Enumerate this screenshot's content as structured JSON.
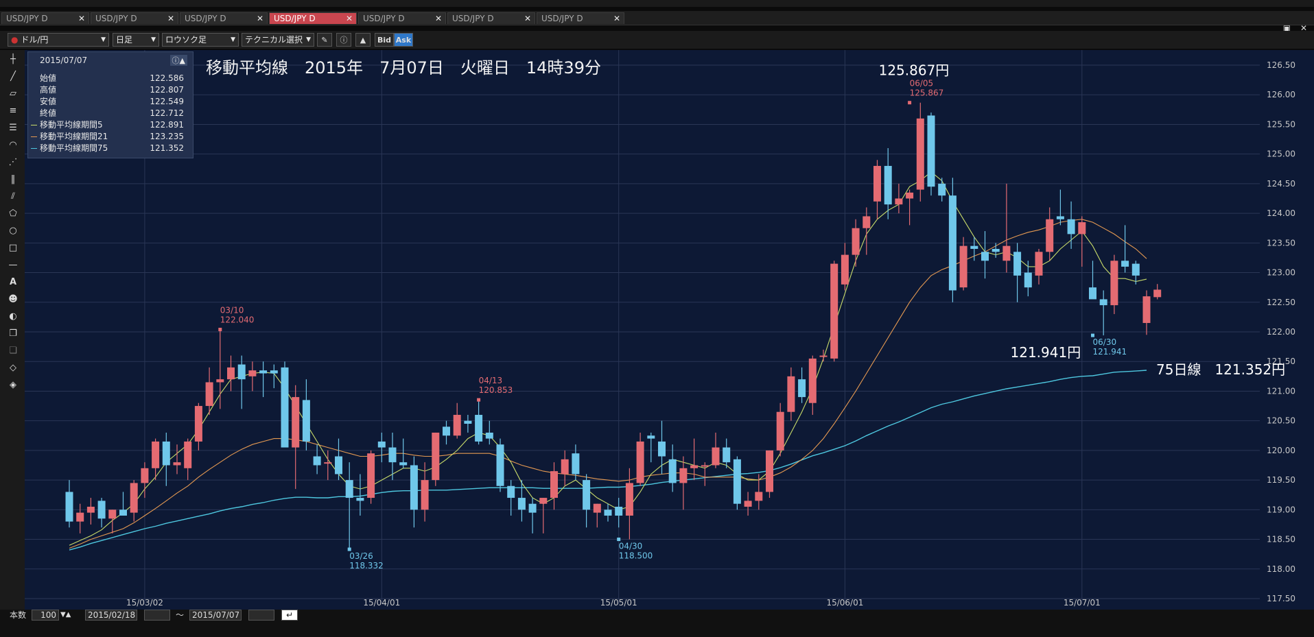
{
  "tabs": [
    {
      "label": "USD/JPY D",
      "active": false
    },
    {
      "label": "USD/JPY D",
      "active": false
    },
    {
      "label": "USD/JPY D",
      "active": false
    },
    {
      "label": "USD/JPY D",
      "active": true
    },
    {
      "label": "USD/JPY D",
      "active": false
    },
    {
      "label": "USD/JPY D",
      "active": false
    },
    {
      "label": "USD/JPY D",
      "active": false
    }
  ],
  "toolbar": {
    "currency": "ドル/円",
    "period": "日足",
    "chart_type": "ロウソク足",
    "technical": "テクニカル選択",
    "bid": "Bid",
    "ask": "Ask"
  },
  "info": {
    "date": "2015/07/07",
    "rows": [
      {
        "label": "始値",
        "value": "122.586"
      },
      {
        "label": "高値",
        "value": "122.807"
      },
      {
        "label": "安値",
        "value": "122.549"
      },
      {
        "label": "終値",
        "value": "122.712"
      },
      {
        "label": "移動平均線期間5",
        "value": "122.891"
      },
      {
        "label": "移動平均線期間21",
        "value": "123.235"
      },
      {
        "label": "移動平均線期間75",
        "value": "121.352"
      }
    ]
  },
  "bottom": {
    "count_label": "本数",
    "count": "100",
    "from": "2015/02/18",
    "tilde": "～",
    "to": "2015/07/07"
  },
  "colors": {
    "up": "#e46b72",
    "down": "#6fc7ea",
    "ma5": "#c9dc6a",
    "ma21": "#e69a52",
    "ma75": "#4ec8e0",
    "background": "#0d1935",
    "grid": "#2a3656"
  },
  "chart_data": {
    "type": "candlestick",
    "title": "移動平均線　2015年　7月07日　火曜日　14時39分",
    "ylim": [
      117.5,
      126.5
    ],
    "yticks": [
      "117.50",
      "118.00",
      "118.50",
      "119.00",
      "119.50",
      "120.00",
      "120.50",
      "121.00",
      "121.50",
      "122.00",
      "122.50",
      "123.00",
      "123.50",
      "124.00",
      "124.50",
      "125.00",
      "125.50",
      "126.00",
      "126.50"
    ],
    "xticks": [
      {
        "label": "15/03/02",
        "index": 7
      },
      {
        "label": "15/04/01",
        "index": 29
      },
      {
        "label": "15/05/01",
        "index": 51
      },
      {
        "label": "15/06/01",
        "index": 72
      },
      {
        "label": "15/07/01",
        "index": 94
      }
    ],
    "candles": [
      {
        "o": 119.3,
        "h": 119.5,
        "l": 118.7,
        "c": 118.8
      },
      {
        "o": 118.8,
        "h": 119.1,
        "l": 118.6,
        "c": 118.95
      },
      {
        "o": 118.95,
        "h": 119.2,
        "l": 118.75,
        "c": 119.05
      },
      {
        "o": 119.15,
        "h": 119.2,
        "l": 118.7,
        "c": 118.85
      },
      {
        "o": 118.85,
        "h": 119.0,
        "l": 118.6,
        "c": 119.0
      },
      {
        "o": 119.0,
        "h": 119.3,
        "l": 118.9,
        "c": 118.9
      },
      {
        "o": 118.95,
        "h": 119.5,
        "l": 118.8,
        "c": 119.45
      },
      {
        "o": 119.45,
        "h": 119.8,
        "l": 119.2,
        "c": 119.7
      },
      {
        "o": 119.7,
        "h": 120.2,
        "l": 119.5,
        "c": 120.15
      },
      {
        "o": 120.15,
        "h": 120.3,
        "l": 119.4,
        "c": 119.75
      },
      {
        "o": 119.75,
        "h": 120.1,
        "l": 119.6,
        "c": 119.8
      },
      {
        "o": 119.7,
        "h": 120.2,
        "l": 119.5,
        "c": 120.15
      },
      {
        "o": 120.15,
        "h": 120.8,
        "l": 120.0,
        "c": 120.75
      },
      {
        "o": 120.75,
        "h": 121.4,
        "l": 120.6,
        "c": 121.15
      },
      {
        "o": 121.15,
        "h": 122.04,
        "l": 120.7,
        "c": 121.2
      },
      {
        "o": 121.2,
        "h": 121.6,
        "l": 121.0,
        "c": 121.4
      },
      {
        "o": 121.45,
        "h": 121.6,
        "l": 120.7,
        "c": 121.2
      },
      {
        "o": 121.25,
        "h": 121.5,
        "l": 121.0,
        "c": 121.35
      },
      {
        "o": 121.35,
        "h": 121.5,
        "l": 120.9,
        "c": 121.3
      },
      {
        "o": 121.35,
        "h": 121.45,
        "l": 121.05,
        "c": 121.3
      },
      {
        "o": 121.4,
        "h": 121.5,
        "l": 121.0,
        "c": 120.05
      },
      {
        "o": 120.05,
        "h": 121.1,
        "l": 119.35,
        "c": 120.9
      },
      {
        "o": 120.85,
        "h": 121.2,
        "l": 120.0,
        "c": 120.15
      },
      {
        "o": 119.9,
        "h": 120.1,
        "l": 119.6,
        "c": 119.75
      },
      {
        "o": 119.8,
        "h": 120.0,
        "l": 119.5,
        "c": 119.8
      },
      {
        "o": 119.9,
        "h": 120.2,
        "l": 119.5,
        "c": 119.6
      },
      {
        "o": 119.5,
        "h": 119.8,
        "l": 118.332,
        "c": 119.2
      },
      {
        "o": 119.2,
        "h": 119.6,
        "l": 118.9,
        "c": 119.15
      },
      {
        "o": 119.2,
        "h": 120.0,
        "l": 119.1,
        "c": 119.95
      },
      {
        "o": 120.15,
        "h": 120.3,
        "l": 119.8,
        "c": 120.05
      },
      {
        "o": 120.05,
        "h": 120.3,
        "l": 119.5,
        "c": 119.8
      },
      {
        "o": 119.8,
        "h": 120.2,
        "l": 119.7,
        "c": 119.75
      },
      {
        "o": 119.75,
        "h": 119.9,
        "l": 118.7,
        "c": 119.0
      },
      {
        "o": 119.0,
        "h": 119.8,
        "l": 118.8,
        "c": 119.5
      },
      {
        "o": 119.5,
        "h": 120.3,
        "l": 119.4,
        "c": 120.3
      },
      {
        "o": 120.4,
        "h": 120.5,
        "l": 120.1,
        "c": 120.25
      },
      {
        "o": 120.25,
        "h": 120.8,
        "l": 120.2,
        "c": 120.6
      },
      {
        "o": 120.5,
        "h": 120.6,
        "l": 120.3,
        "c": 120.45
      },
      {
        "o": 120.6,
        "h": 120.853,
        "l": 120.1,
        "c": 120.15
      },
      {
        "o": 120.3,
        "h": 120.5,
        "l": 120.1,
        "c": 120.2
      },
      {
        "o": 120.1,
        "h": 120.2,
        "l": 119.3,
        "c": 119.4
      },
      {
        "o": 119.4,
        "h": 119.5,
        "l": 118.9,
        "c": 119.2
      },
      {
        "o": 119.2,
        "h": 119.5,
        "l": 118.8,
        "c": 119.0
      },
      {
        "o": 119.1,
        "h": 119.2,
        "l": 118.6,
        "c": 118.95
      },
      {
        "o": 119.1,
        "h": 119.2,
        "l": 118.6,
        "c": 119.2
      },
      {
        "o": 119.2,
        "h": 119.8,
        "l": 119.0,
        "c": 119.65
      },
      {
        "o": 119.6,
        "h": 120.0,
        "l": 119.4,
        "c": 119.85
      },
      {
        "o": 119.95,
        "h": 120.1,
        "l": 119.5,
        "c": 119.6
      },
      {
        "o": 119.5,
        "h": 119.6,
        "l": 118.7,
        "c": 119.0
      },
      {
        "o": 118.95,
        "h": 119.1,
        "l": 118.7,
        "c": 119.1
      },
      {
        "o": 119.0,
        "h": 119.1,
        "l": 118.8,
        "c": 118.9
      },
      {
        "o": 119.05,
        "h": 119.2,
        "l": 118.7,
        "c": 118.9
      },
      {
        "o": 118.9,
        "h": 119.7,
        "l": 118.5,
        "c": 119.45
      },
      {
        "o": 119.45,
        "h": 120.3,
        "l": 119.4,
        "c": 120.15
      },
      {
        "o": 120.25,
        "h": 120.3,
        "l": 119.8,
        "c": 120.2
      },
      {
        "o": 120.15,
        "h": 120.5,
        "l": 119.6,
        "c": 119.9
      },
      {
        "o": 119.85,
        "h": 120.1,
        "l": 119.3,
        "c": 119.45
      },
      {
        "o": 119.45,
        "h": 119.9,
        "l": 119.0,
        "c": 119.7
      },
      {
        "o": 119.7,
        "h": 120.2,
        "l": 119.5,
        "c": 119.75
      },
      {
        "o": 119.75,
        "h": 119.8,
        "l": 119.4,
        "c": 119.75
      },
      {
        "o": 119.75,
        "h": 120.3,
        "l": 119.7,
        "c": 120.05
      },
      {
        "o": 120.05,
        "h": 120.2,
        "l": 119.7,
        "c": 119.8
      },
      {
        "o": 119.85,
        "h": 119.9,
        "l": 119.0,
        "c": 119.1
      },
      {
        "o": 119.05,
        "h": 119.3,
        "l": 118.9,
        "c": 119.15
      },
      {
        "o": 119.15,
        "h": 119.6,
        "l": 119.0,
        "c": 119.3
      },
      {
        "o": 119.3,
        "h": 120.0,
        "l": 119.2,
        "c": 120.0
      },
      {
        "o": 120.0,
        "h": 120.8,
        "l": 119.9,
        "c": 120.65
      },
      {
        "o": 120.65,
        "h": 121.4,
        "l": 120.5,
        "c": 121.25
      },
      {
        "o": 121.2,
        "h": 121.4,
        "l": 120.8,
        "c": 120.9
      },
      {
        "o": 120.8,
        "h": 121.6,
        "l": 120.6,
        "c": 121.55
      },
      {
        "o": 121.6,
        "h": 121.7,
        "l": 121.5,
        "c": 121.6
      },
      {
        "o": 121.55,
        "h": 123.2,
        "l": 121.5,
        "c": 123.15
      },
      {
        "o": 122.8,
        "h": 123.5,
        "l": 122.7,
        "c": 123.3
      },
      {
        "o": 123.3,
        "h": 123.9,
        "l": 123.1,
        "c": 123.75
      },
      {
        "o": 123.75,
        "h": 124.1,
        "l": 123.3,
        "c": 123.95
      },
      {
        "o": 124.2,
        "h": 124.9,
        "l": 123.9,
        "c": 124.8
      },
      {
        "o": 124.8,
        "h": 125.1,
        "l": 123.9,
        "c": 124.15
      },
      {
        "o": 124.15,
        "h": 124.5,
        "l": 124.0,
        "c": 124.25
      },
      {
        "o": 124.25,
        "h": 124.4,
        "l": 123.8,
        "c": 124.35
      },
      {
        "o": 124.4,
        "h": 125.867,
        "l": 124.2,
        "c": 125.6
      },
      {
        "o": 125.65,
        "h": 125.7,
        "l": 124.3,
        "c": 124.45
      },
      {
        "o": 124.5,
        "h": 124.6,
        "l": 124.2,
        "c": 124.3
      },
      {
        "o": 124.3,
        "h": 124.6,
        "l": 122.5,
        "c": 122.7
      },
      {
        "o": 122.75,
        "h": 123.6,
        "l": 122.7,
        "c": 123.45
      },
      {
        "o": 123.45,
        "h": 123.6,
        "l": 123.2,
        "c": 123.4
      },
      {
        "o": 123.35,
        "h": 123.7,
        "l": 122.9,
        "c": 123.2
      },
      {
        "o": 123.4,
        "h": 123.5,
        "l": 123.25,
        "c": 123.35
      },
      {
        "o": 123.2,
        "h": 124.5,
        "l": 123.0,
        "c": 123.45
      },
      {
        "o": 123.35,
        "h": 123.5,
        "l": 122.5,
        "c": 122.95
      },
      {
        "o": 123.0,
        "h": 123.2,
        "l": 122.6,
        "c": 122.75
      },
      {
        "o": 122.95,
        "h": 123.4,
        "l": 122.8,
        "c": 123.35
      },
      {
        "o": 123.35,
        "h": 124.1,
        "l": 123.2,
        "c": 123.9
      },
      {
        "o": 123.95,
        "h": 124.4,
        "l": 123.8,
        "c": 123.9
      },
      {
        "o": 123.9,
        "h": 124.2,
        "l": 123.4,
        "c": 123.65
      },
      {
        "o": 123.65,
        "h": 123.95,
        "l": 123.1,
        "c": 123.85
      },
      {
        "o": 122.75,
        "h": 123.2,
        "l": 122.6,
        "c": 122.55
      },
      {
        "o": 122.55,
        "h": 122.7,
        "l": 121.941,
        "c": 122.45
      },
      {
        "o": 122.45,
        "h": 123.3,
        "l": 122.3,
        "c": 123.2
      },
      {
        "o": 123.2,
        "h": 123.8,
        "l": 123.0,
        "c": 123.1
      },
      {
        "o": 123.15,
        "h": 123.2,
        "l": 122.8,
        "c": 122.95
      },
      {
        "o": 122.15,
        "h": 122.7,
        "l": 121.95,
        "c": 122.6
      },
      {
        "o": 122.586,
        "h": 122.807,
        "l": 122.549,
        "c": 122.712
      }
    ],
    "series": [
      {
        "name": "移動平均線期間5",
        "values": [
          118.4,
          118.48,
          118.56,
          118.66,
          118.82,
          118.95,
          119.1,
          119.35,
          119.55,
          119.8,
          119.95,
          120.1,
          120.35,
          120.65,
          120.95,
          121.2,
          121.25,
          121.3,
          121.32,
          121.3,
          121.05,
          120.75,
          120.45,
          120.15,
          119.85,
          119.6,
          119.4,
          119.35,
          119.4,
          119.5,
          119.6,
          119.7,
          119.7,
          119.65,
          119.72,
          119.85,
          120.0,
          120.2,
          120.3,
          120.25,
          120.05,
          119.8,
          119.45,
          119.2,
          119.1,
          119.2,
          119.4,
          119.5,
          119.35,
          119.2,
          119.1,
          119.0,
          119.05,
          119.3,
          119.6,
          119.75,
          119.85,
          119.8,
          119.75,
          119.7,
          119.8,
          119.75,
          119.6,
          119.5,
          119.5,
          119.65,
          119.95,
          120.3,
          120.65,
          121.05,
          121.55,
          122.1,
          122.65,
          123.2,
          123.65,
          123.9,
          124.05,
          124.15,
          124.45,
          124.55,
          124.7,
          124.55,
          124.2,
          123.9,
          123.6,
          123.35,
          123.3,
          123.35,
          123.25,
          123.1,
          123.1,
          123.2,
          123.4,
          123.55,
          123.7,
          123.45,
          123.1,
          122.9,
          122.9,
          122.85,
          122.89
        ]
      },
      {
        "name": "移動平均線期間21",
        "values": [
          118.35,
          118.42,
          118.5,
          118.56,
          118.62,
          118.68,
          118.78,
          118.9,
          119.02,
          119.15,
          119.28,
          119.4,
          119.55,
          119.68,
          119.8,
          119.92,
          120.02,
          120.1,
          120.15,
          120.2,
          120.2,
          120.18,
          120.15,
          120.1,
          120.05,
          120.0,
          119.95,
          119.9,
          119.9,
          119.92,
          119.95,
          119.95,
          119.92,
          119.9,
          119.9,
          119.92,
          119.95,
          119.95,
          119.95,
          119.95,
          119.9,
          119.82,
          119.75,
          119.7,
          119.65,
          119.62,
          119.6,
          119.58,
          119.55,
          119.52,
          119.5,
          119.48,
          119.5,
          119.55,
          119.58,
          119.6,
          119.62,
          119.62,
          119.6,
          119.55,
          119.55,
          119.55,
          119.55,
          119.52,
          119.5,
          119.55,
          119.62,
          119.72,
          119.85,
          120.0,
          120.2,
          120.45,
          120.72,
          121.0,
          121.3,
          121.6,
          121.9,
          122.2,
          122.5,
          122.75,
          122.95,
          123.05,
          123.12,
          123.2,
          123.28,
          123.35,
          123.45,
          123.55,
          123.62,
          123.68,
          123.72,
          123.78,
          123.85,
          123.88,
          123.9,
          123.85,
          123.75,
          123.65,
          123.52,
          123.4,
          123.235
        ]
      },
      {
        "name": "移動平均線期間75",
        "values": [
          118.32,
          118.37,
          118.43,
          118.48,
          118.53,
          118.58,
          118.63,
          118.68,
          118.72,
          118.77,
          118.81,
          118.85,
          118.89,
          118.93,
          118.98,
          119.02,
          119.05,
          119.09,
          119.12,
          119.16,
          119.19,
          119.21,
          119.21,
          119.2,
          119.2,
          119.22,
          119.22,
          119.23,
          119.26,
          119.29,
          119.31,
          119.32,
          119.32,
          119.33,
          119.33,
          119.33,
          119.34,
          119.35,
          119.36,
          119.37,
          119.37,
          119.37,
          119.37,
          119.37,
          119.36,
          119.36,
          119.36,
          119.36,
          119.36,
          119.37,
          119.38,
          119.38,
          119.39,
          119.41,
          119.43,
          119.46,
          119.48,
          119.5,
          119.52,
          119.54,
          119.56,
          119.58,
          119.6,
          119.61,
          119.63,
          119.66,
          119.71,
          119.77,
          119.84,
          119.91,
          119.96,
          120.02,
          120.08,
          120.16,
          120.25,
          120.33,
          120.41,
          120.48,
          120.56,
          120.64,
          120.72,
          120.78,
          120.82,
          120.87,
          120.92,
          120.96,
          121.0,
          121.04,
          121.07,
          121.1,
          121.13,
          121.16,
          121.2,
          121.23,
          121.25,
          121.26,
          121.29,
          121.32,
          121.33,
          121.34,
          121.352
        ]
      }
    ],
    "annotations": [
      {
        "index": 14,
        "price": 122.04,
        "date": "03/10",
        "value": "122.040",
        "kind": "high"
      },
      {
        "index": 26,
        "price": 118.332,
        "date": "03/26",
        "value": "118.332",
        "kind": "low"
      },
      {
        "index": 38,
        "price": 120.853,
        "date": "04/13",
        "value": "120.853",
        "kind": "high"
      },
      {
        "index": 51,
        "price": 118.5,
        "date": "04/30",
        "value": "118.500",
        "kind": "low"
      },
      {
        "index": 78,
        "price": 125.867,
        "date": "06/05",
        "value": "125.867",
        "kind": "high"
      },
      {
        "index": 95,
        "price": 121.941,
        "date": "06/30",
        "value": "121.941",
        "kind": "low"
      }
    ],
    "big_labels": {
      "high": "125.867円",
      "low": "121.941円",
      "ma75": "75日線　121.352円"
    }
  }
}
